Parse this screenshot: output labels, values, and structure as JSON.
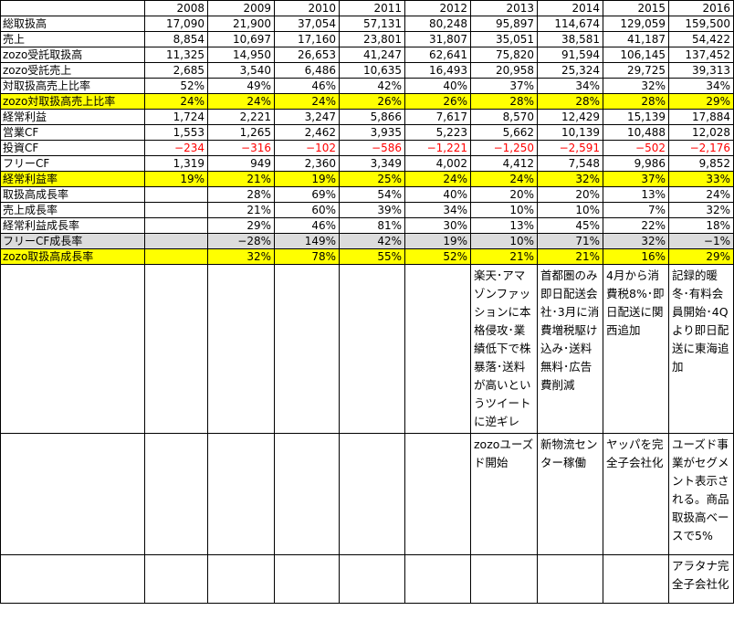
{
  "years": [
    "2008",
    "2009",
    "2010",
    "2011",
    "2012",
    "2013",
    "2014",
    "2015",
    "2016"
  ],
  "rows": [
    {
      "label": "総取扱高",
      "style": "",
      "values": [
        "17,090",
        "21,900",
        "37,054",
        "57,131",
        "80,248",
        "95,897",
        "114,674",
        "129,059",
        "159,500"
      ]
    },
    {
      "label": "売上",
      "style": "",
      "values": [
        "8,854",
        "10,697",
        "17,160",
        "23,801",
        "31,807",
        "35,051",
        "38,581",
        "41,187",
        "54,422"
      ]
    },
    {
      "label": "zozo受託取扱高",
      "style": "",
      "values": [
        "11,325",
        "14,950",
        "26,653",
        "41,247",
        "62,641",
        "75,820",
        "91,594",
        "106,145",
        "137,452"
      ]
    },
    {
      "label": "zozo受託売上",
      "style": "",
      "values": [
        "2,685",
        "3,540",
        "6,486",
        "10,635",
        "16,493",
        "20,958",
        "25,324",
        "29,725",
        "39,313"
      ]
    },
    {
      "label": "対取扱高売上比率",
      "style": "",
      "values": [
        "52%",
        "49%",
        "46%",
        "42%",
        "40%",
        "37%",
        "34%",
        "32%",
        "34%"
      ]
    },
    {
      "label": "zozo対取扱高売上比率",
      "style": "yellow",
      "values": [
        "24%",
        "24%",
        "24%",
        "26%",
        "26%",
        "28%",
        "28%",
        "28%",
        "29%"
      ]
    },
    {
      "label": "経常利益",
      "style": "",
      "values": [
        "1,724",
        "2,221",
        "3,247",
        "5,866",
        "7,617",
        "8,570",
        "12,429",
        "15,139",
        "17,884"
      ]
    },
    {
      "label": "営業CF",
      "style": "",
      "values": [
        "1,553",
        "1,265",
        "2,462",
        "3,935",
        "5,223",
        "5,662",
        "10,139",
        "10,488",
        "12,028"
      ]
    },
    {
      "label": "投資CF",
      "style": "",
      "values": [
        "−234",
        "−316",
        "−102",
        "−586",
        "−1,221",
        "−1,250",
        "−2,591",
        "−502",
        "−2,176"
      ],
      "negative": true
    },
    {
      "label": "フリーCF",
      "style": "",
      "values": [
        "1,319",
        "949",
        "2,360",
        "3,349",
        "4,002",
        "4,412",
        "7,548",
        "9,986",
        "9,852"
      ]
    },
    {
      "label": "経常利益率",
      "style": "yellow",
      "values": [
        "19%",
        "21%",
        "19%",
        "25%",
        "24%",
        "24%",
        "32%",
        "37%",
        "33%"
      ]
    },
    {
      "label": "取扱高成長率",
      "style": "",
      "values": [
        "",
        "28%",
        "69%",
        "54%",
        "40%",
        "20%",
        "20%",
        "13%",
        "24%"
      ]
    },
    {
      "label": "売上成長率",
      "style": "",
      "values": [
        "",
        "21%",
        "60%",
        "39%",
        "34%",
        "10%",
        "10%",
        "7%",
        "32%"
      ]
    },
    {
      "label": "経常利益成長率",
      "style": "",
      "values": [
        "",
        "29%",
        "46%",
        "81%",
        "30%",
        "13%",
        "45%",
        "22%",
        "18%"
      ]
    },
    {
      "label": "フリーCF成長率",
      "style": "gray",
      "values": [
        "",
        "−28%",
        "149%",
        "42%",
        "19%",
        "10%",
        "71%",
        "32%",
        "−1%"
      ]
    },
    {
      "label": "zozo取扱高成長率",
      "style": "yellow",
      "values": [
        "",
        "32%",
        "78%",
        "55%",
        "52%",
        "21%",
        "21%",
        "16%",
        "29%"
      ]
    }
  ],
  "notes": [
    [
      "",
      "",
      "",
      "",
      "",
      "",
      "楽天･アマゾンファッションに本格侵攻･業績低下で株暴落･送料が高いというツイートに逆ギレ",
      "首都圏のみ即日配送会社･3月に消費増税駆け込み･送料無料･広告費削減",
      "4月から消費税8%･即日配送に関西追加",
      "記録的暖冬･有料会員開始･4Qより即日配送に東海追加"
    ],
    [
      "",
      "",
      "",
      "",
      "",
      "",
      "zozoユーズド開始",
      "新物流センター稼働",
      "ヤッパを完全子会社化",
      "ユーズド事業がセグメント表示される。商品取扱高ベースで5%"
    ],
    [
      "",
      "",
      "",
      "",
      "",
      "",
      "",
      "",
      "",
      "アラタナ完全子会社化"
    ]
  ]
}
